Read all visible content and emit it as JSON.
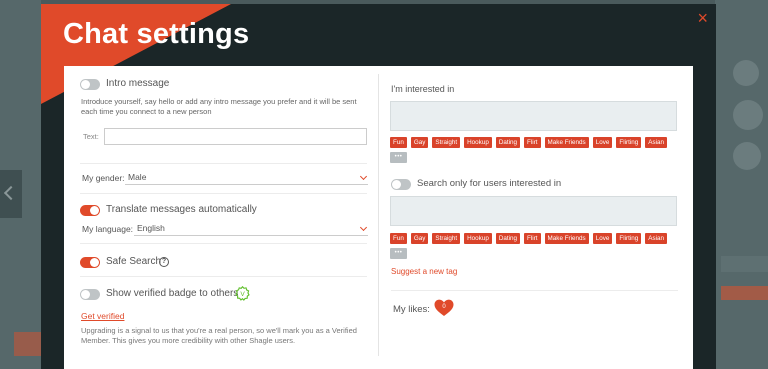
{
  "modal": {
    "title": "Chat settings",
    "close_label": "×"
  },
  "left": {
    "intro": {
      "label": "Intro message",
      "on": false,
      "description": "Introduce yourself, say hello or add any intro message you prefer and it will be sent each time you connect to a new person",
      "text_label": "Text:",
      "text_value": ""
    },
    "gender": {
      "label": "My gender:",
      "value": "Male"
    },
    "translate": {
      "label": "Translate messages automatically",
      "on": true,
      "language_label": "My language:",
      "language_value": "English"
    },
    "safe_search": {
      "label": "Safe Search",
      "on": true,
      "help_glyph": "?"
    },
    "verified": {
      "label": "Show verified badge to others",
      "on": false,
      "badge_glyph": "V",
      "get_verified": "Get verified",
      "note": "Upgrading is a signal to us that you're a real person, so we'll mark you as a Verified Member. This gives you more credibility with other Shagle users."
    }
  },
  "right": {
    "interested_label": "I'm interested in",
    "interested_tags": [
      "Fun",
      "Gay",
      "Straight",
      "Hookup",
      "Dating",
      "Flirt",
      "Make Friends",
      "Love",
      "Flirting",
      "Asian"
    ],
    "more_label": "•••",
    "search_only": {
      "label": "Search only for users interested in",
      "on": false
    },
    "search_tags": [
      "Fun",
      "Gay",
      "Straight",
      "Hookup",
      "Dating",
      "Flirt",
      "Make Friends",
      "Love",
      "Flirting",
      "Asian"
    ],
    "suggest_label": "Suggest a new tag",
    "likes_label": "My likes:",
    "likes_count": "0"
  },
  "colors": {
    "accent": "#e04a2a",
    "modal_bg": "#1b2628",
    "panel_bg": "#ffffff"
  }
}
